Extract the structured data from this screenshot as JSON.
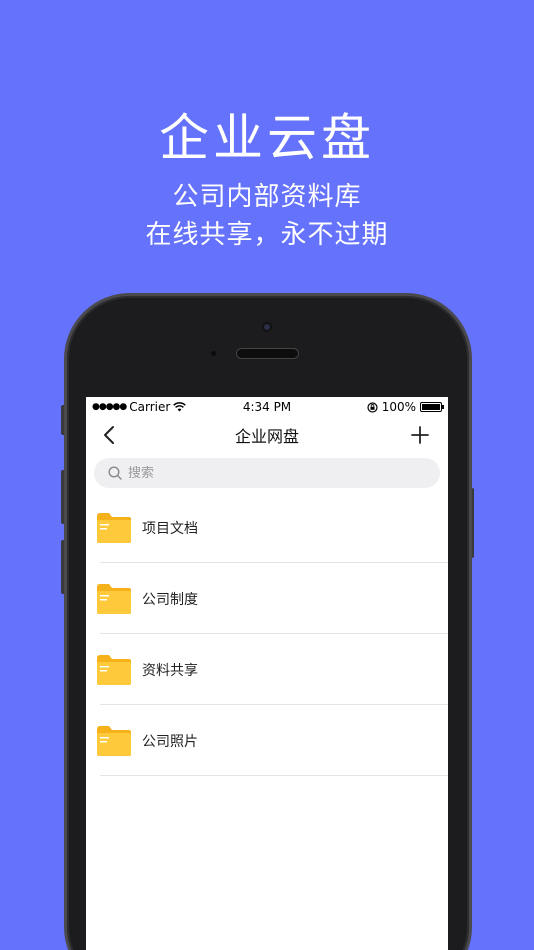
{
  "promo": {
    "headline": "企业云盘",
    "line1": "公司内部资料库",
    "line2": "在线共享，永不过期"
  },
  "status_bar": {
    "carrier": "Carrier",
    "time": "4:34 PM",
    "battery": "100%"
  },
  "nav": {
    "title": "企业网盘",
    "back_icon": "chevron-left-icon",
    "add_icon": "plus-icon"
  },
  "search": {
    "placeholder": "搜索"
  },
  "folders": [
    {
      "label": "项目文档"
    },
    {
      "label": "公司制度"
    },
    {
      "label": "资料共享"
    },
    {
      "label": "公司照片"
    }
  ],
  "colors": {
    "background": "#6572fb",
    "folder": "#ffc93c",
    "folder_tab": "#f5b21b"
  }
}
